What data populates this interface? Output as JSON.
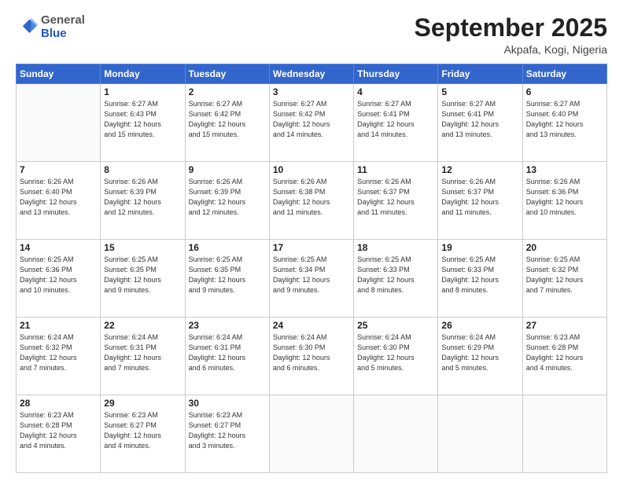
{
  "header": {
    "logo_general": "General",
    "logo_blue": "Blue",
    "month": "September 2025",
    "location": "Akpafa, Kogi, Nigeria"
  },
  "days_of_week": [
    "Sunday",
    "Monday",
    "Tuesday",
    "Wednesday",
    "Thursday",
    "Friday",
    "Saturday"
  ],
  "weeks": [
    [
      {
        "day": "",
        "info": ""
      },
      {
        "day": "1",
        "info": "Sunrise: 6:27 AM\nSunset: 6:43 PM\nDaylight: 12 hours\nand 15 minutes."
      },
      {
        "day": "2",
        "info": "Sunrise: 6:27 AM\nSunset: 6:42 PM\nDaylight: 12 hours\nand 15 minutes."
      },
      {
        "day": "3",
        "info": "Sunrise: 6:27 AM\nSunset: 6:42 PM\nDaylight: 12 hours\nand 14 minutes."
      },
      {
        "day": "4",
        "info": "Sunrise: 6:27 AM\nSunset: 6:41 PM\nDaylight: 12 hours\nand 14 minutes."
      },
      {
        "day": "5",
        "info": "Sunrise: 6:27 AM\nSunset: 6:41 PM\nDaylight: 12 hours\nand 13 minutes."
      },
      {
        "day": "6",
        "info": "Sunrise: 6:27 AM\nSunset: 6:40 PM\nDaylight: 12 hours\nand 13 minutes."
      }
    ],
    [
      {
        "day": "7",
        "info": "Sunrise: 6:26 AM\nSunset: 6:40 PM\nDaylight: 12 hours\nand 13 minutes."
      },
      {
        "day": "8",
        "info": "Sunrise: 6:26 AM\nSunset: 6:39 PM\nDaylight: 12 hours\nand 12 minutes."
      },
      {
        "day": "9",
        "info": "Sunrise: 6:26 AM\nSunset: 6:39 PM\nDaylight: 12 hours\nand 12 minutes."
      },
      {
        "day": "10",
        "info": "Sunrise: 6:26 AM\nSunset: 6:38 PM\nDaylight: 12 hours\nand 11 minutes."
      },
      {
        "day": "11",
        "info": "Sunrise: 6:26 AM\nSunset: 6:37 PM\nDaylight: 12 hours\nand 11 minutes."
      },
      {
        "day": "12",
        "info": "Sunrise: 6:26 AM\nSunset: 6:37 PM\nDaylight: 12 hours\nand 11 minutes."
      },
      {
        "day": "13",
        "info": "Sunrise: 6:26 AM\nSunset: 6:36 PM\nDaylight: 12 hours\nand 10 minutes."
      }
    ],
    [
      {
        "day": "14",
        "info": "Sunrise: 6:25 AM\nSunset: 6:36 PM\nDaylight: 12 hours\nand 10 minutes."
      },
      {
        "day": "15",
        "info": "Sunrise: 6:25 AM\nSunset: 6:35 PM\nDaylight: 12 hours\nand 9 minutes."
      },
      {
        "day": "16",
        "info": "Sunrise: 6:25 AM\nSunset: 6:35 PM\nDaylight: 12 hours\nand 9 minutes."
      },
      {
        "day": "17",
        "info": "Sunrise: 6:25 AM\nSunset: 6:34 PM\nDaylight: 12 hours\nand 9 minutes."
      },
      {
        "day": "18",
        "info": "Sunrise: 6:25 AM\nSunset: 6:33 PM\nDaylight: 12 hours\nand 8 minutes."
      },
      {
        "day": "19",
        "info": "Sunrise: 6:25 AM\nSunset: 6:33 PM\nDaylight: 12 hours\nand 8 minutes."
      },
      {
        "day": "20",
        "info": "Sunrise: 6:25 AM\nSunset: 6:32 PM\nDaylight: 12 hours\nand 7 minutes."
      }
    ],
    [
      {
        "day": "21",
        "info": "Sunrise: 6:24 AM\nSunset: 6:32 PM\nDaylight: 12 hours\nand 7 minutes."
      },
      {
        "day": "22",
        "info": "Sunrise: 6:24 AM\nSunset: 6:31 PM\nDaylight: 12 hours\nand 7 minutes."
      },
      {
        "day": "23",
        "info": "Sunrise: 6:24 AM\nSunset: 6:31 PM\nDaylight: 12 hours\nand 6 minutes."
      },
      {
        "day": "24",
        "info": "Sunrise: 6:24 AM\nSunset: 6:30 PM\nDaylight: 12 hours\nand 6 minutes."
      },
      {
        "day": "25",
        "info": "Sunrise: 6:24 AM\nSunset: 6:30 PM\nDaylight: 12 hours\nand 5 minutes."
      },
      {
        "day": "26",
        "info": "Sunrise: 6:24 AM\nSunset: 6:29 PM\nDaylight: 12 hours\nand 5 minutes."
      },
      {
        "day": "27",
        "info": "Sunrise: 6:23 AM\nSunset: 6:28 PM\nDaylight: 12 hours\nand 4 minutes."
      }
    ],
    [
      {
        "day": "28",
        "info": "Sunrise: 6:23 AM\nSunset: 6:28 PM\nDaylight: 12 hours\nand 4 minutes."
      },
      {
        "day": "29",
        "info": "Sunrise: 6:23 AM\nSunset: 6:27 PM\nDaylight: 12 hours\nand 4 minutes."
      },
      {
        "day": "30",
        "info": "Sunrise: 6:23 AM\nSunset: 6:27 PM\nDaylight: 12 hours\nand 3 minutes."
      },
      {
        "day": "",
        "info": ""
      },
      {
        "day": "",
        "info": ""
      },
      {
        "day": "",
        "info": ""
      },
      {
        "day": "",
        "info": ""
      }
    ]
  ]
}
